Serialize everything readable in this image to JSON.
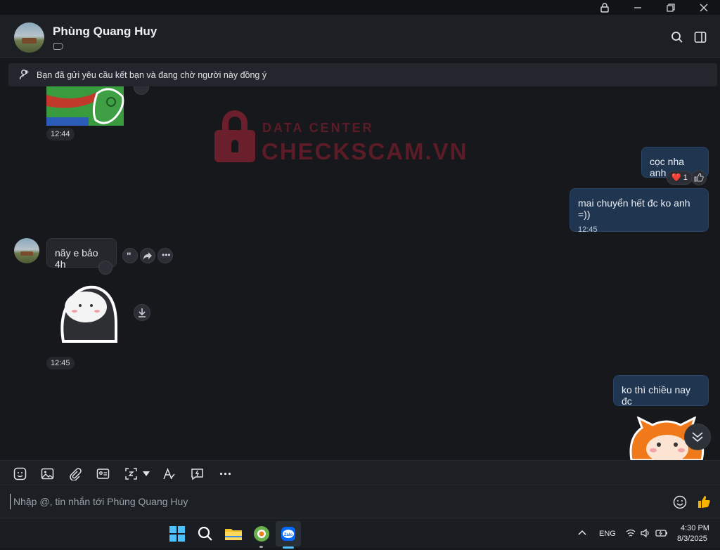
{
  "window": {
    "lock_icon": "lock-icon",
    "minimize_icon": "minimize-icon",
    "restore_icon": "restore-icon",
    "close_icon": "close-icon"
  },
  "header": {
    "contact_name": "Phùng Quang Huy",
    "tag_icon": "tag-icon",
    "search_icon": "search-icon",
    "panel_icon": "sidebar-panel-icon"
  },
  "banner": {
    "text": "Bạn đã gửi yêu cầu kết bạn và đang chờ người này đồng ý",
    "icon": "person-pending-icon"
  },
  "watermark": {
    "line1": "DATA CENTER",
    "line2": "CHECKSCAM.VN"
  },
  "messages": [
    {
      "id": "sticker-frog",
      "side": "in",
      "type": "sticker",
      "time": "12:44"
    },
    {
      "id": "m1",
      "side": "out",
      "text": "cọc nha anh",
      "reaction": {
        "emoji": "❤️",
        "count": "1"
      }
    },
    {
      "id": "m2",
      "side": "out",
      "text": "mai chuyển hết đc ko anh =))",
      "time": "12:45"
    },
    {
      "id": "m3",
      "side": "in",
      "text": "nãy e bảo 4h"
    },
    {
      "id": "sticker-ghost",
      "side": "in",
      "type": "sticker",
      "time": "12:45"
    },
    {
      "id": "m4",
      "side": "out",
      "text": "ko thì chiều nay đc"
    },
    {
      "id": "sticker-fox",
      "side": "out",
      "type": "sticker"
    }
  ],
  "composer": {
    "placeholder": "Nhập @, tin nhắn tới Phùng Quang Huy",
    "tools": [
      "sticker-icon",
      "image-icon",
      "attachment-icon",
      "contact-card-icon",
      "screenshot-icon",
      "text-format-icon",
      "quick-message-icon",
      "more-icon"
    ]
  },
  "taskbar": {
    "language": "ENG",
    "time": "4:30 PM",
    "date": "8/3/2025"
  },
  "colors": {
    "background": "#16181c",
    "outgoing_bubble": "#1f3550",
    "incoming_bubble": "#24272c",
    "watermark": "#6b1f2c"
  }
}
